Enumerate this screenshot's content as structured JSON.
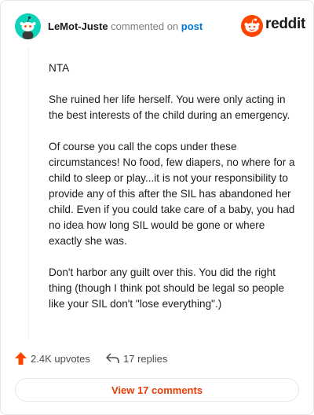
{
  "header": {
    "username": "LeMot-Juste",
    "action_text": " commented on ",
    "post_link": "post",
    "brand": "reddit"
  },
  "comment": {
    "paragraphs": [
      "NTA",
      "She ruined her life herself. You were only acting in the best interests of the child during an emergency.",
      "Of course you call the cops under these circumstances! No food, few diapers, no where for a child to sleep or play...it is not your responsibility to provide any of this after the SIL has abandoned her child. Even if you could take care of a baby, you had no idea how long SIL would be gone or where exactly she was.",
      "Don't harbor any guilt over this. You did the right thing (though I think pot should be legal so people like your SIL don't \"lose everything\".)"
    ]
  },
  "footer": {
    "upvotes": "2.4K upvotes",
    "replies": "17 replies",
    "view_comments": "View 17 comments"
  },
  "colors": {
    "accent": "#ea3d06",
    "avatar_bg": "#0dd3bb",
    "link": "#0079d3",
    "brand_orange": "#ff4500"
  },
  "icons": {
    "avatar": "snoo-avatar-icon",
    "brand": "reddit-logo-icon",
    "upvote": "upvote-arrow-icon",
    "reply": "reply-arrow-icon"
  }
}
